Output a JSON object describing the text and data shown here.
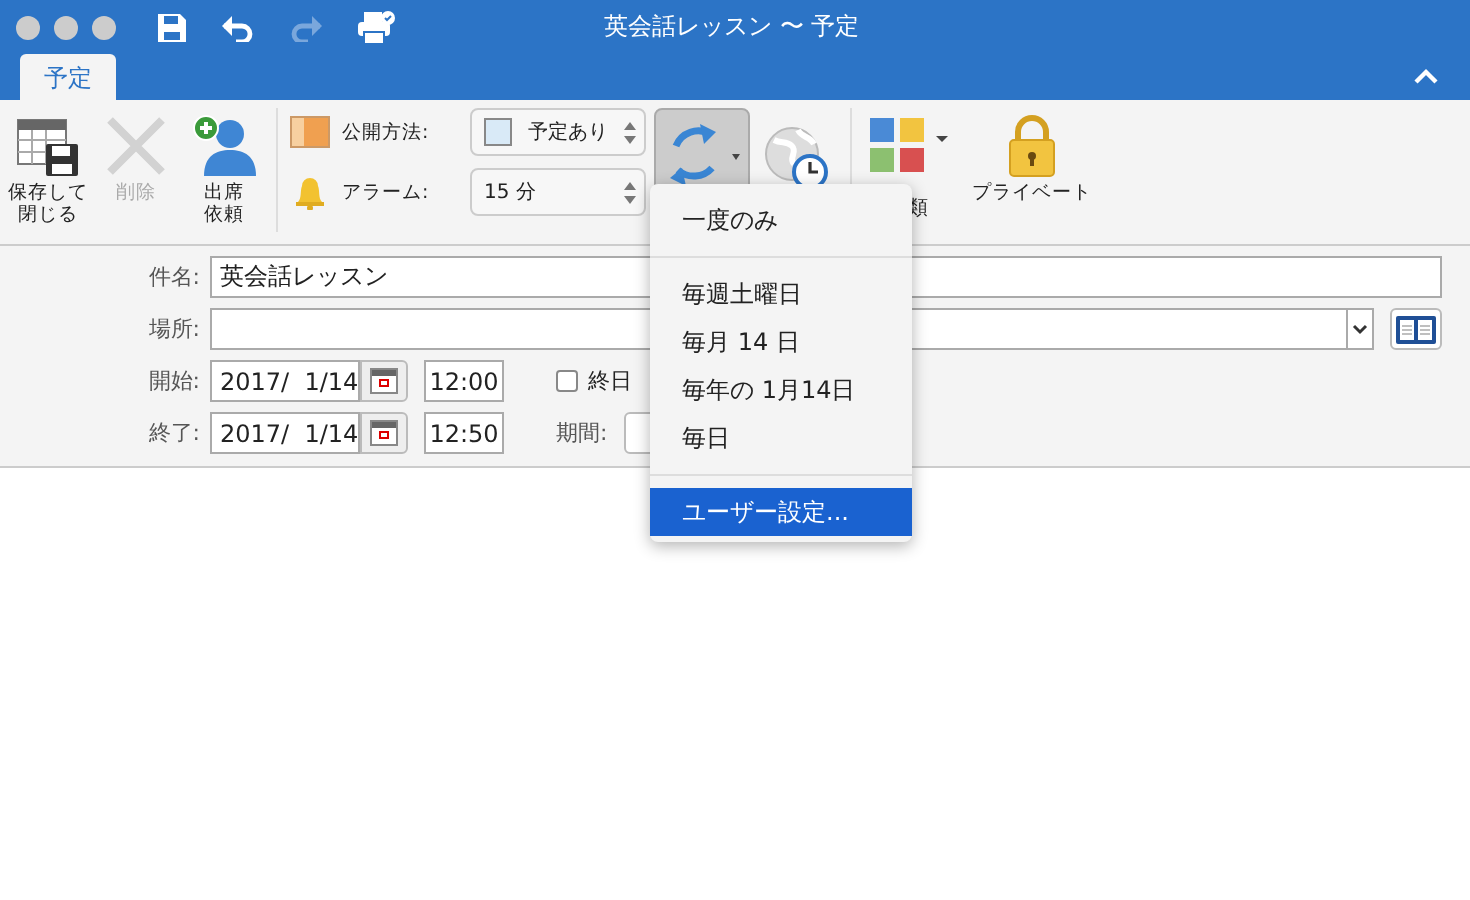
{
  "window": {
    "title": "英会話レッスン 〜 予定"
  },
  "tabs": [
    {
      "label": "予定",
      "selected": true
    }
  ],
  "ribbon": {
    "buttons": [
      {
        "lines": [
          "保存して",
          "閉じる"
        ],
        "disabled": false,
        "kind": "save"
      },
      {
        "lines": [
          "削除"
        ],
        "disabled": true,
        "kind": "delete"
      },
      {
        "lines": [
          "出席",
          "依頼"
        ],
        "disabled": false,
        "kind": "attendee"
      }
    ],
    "show_as": {
      "label": "公開方法:",
      "value": "予定あり"
    },
    "reminder": {
      "label": "アラーム:",
      "value": "15 分"
    },
    "category": {
      "label": "類"
    },
    "private": {
      "label": "プライベート"
    }
  },
  "form": {
    "subject": {
      "label": "件名:",
      "value": "英会話レッスン"
    },
    "location": {
      "label": "場所:"
    },
    "start": {
      "label": "開始:",
      "date": "2017/  1/14",
      "time": "12:00"
    },
    "end": {
      "label": "終了:",
      "date": "2017/  1/14",
      "time": "12:50"
    },
    "all_day": {
      "label": "終日",
      "checked": false
    },
    "duration": {
      "label": "期間:"
    }
  },
  "recurrence_menu": {
    "groups": [
      {
        "items": [
          {
            "label": "一度のみ",
            "selected": false
          }
        ]
      },
      {
        "items": [
          {
            "label": "毎週土曜日",
            "selected": false
          },
          {
            "label": "毎月 14 日",
            "selected": false
          },
          {
            "label": "毎年の 1月14日",
            "selected": false
          },
          {
            "label": "毎日",
            "selected": false
          }
        ]
      },
      {
        "items": [
          {
            "label": "ユーザー設定...",
            "selected": true
          }
        ]
      }
    ]
  }
}
